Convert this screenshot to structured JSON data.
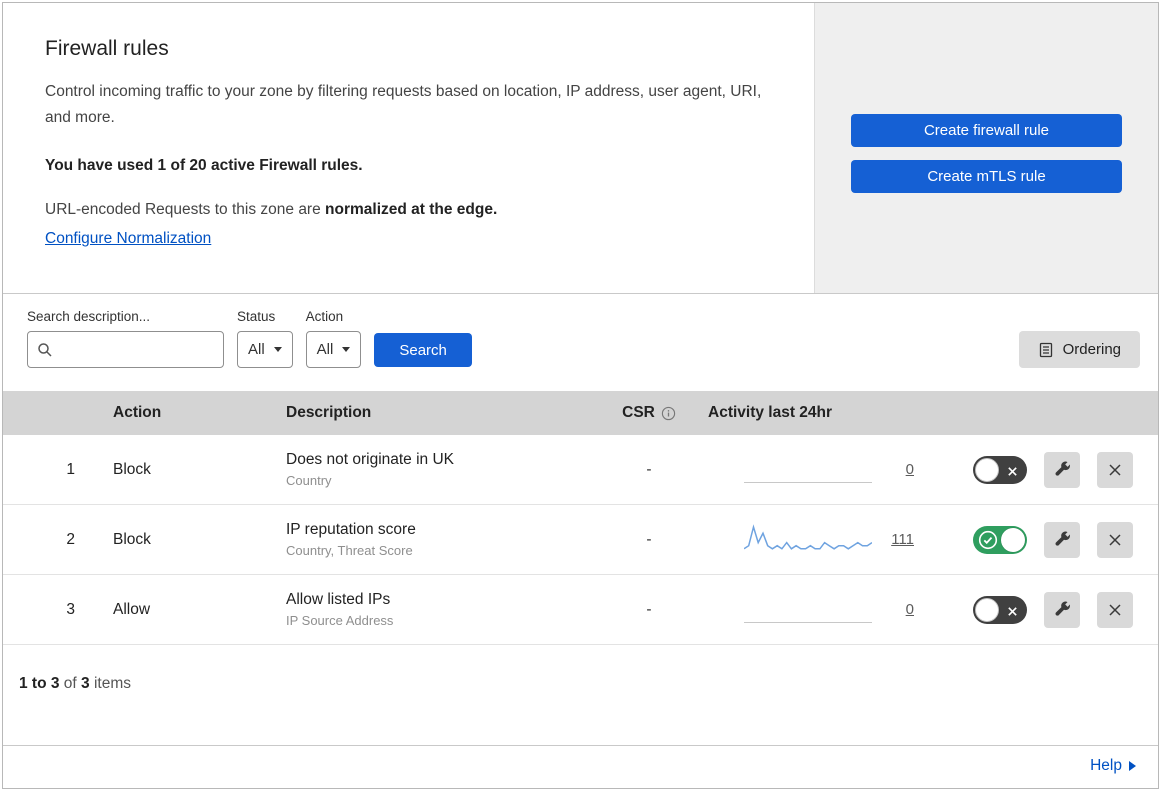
{
  "colors": {
    "primary_blue": "#1560d4",
    "link_blue": "#0051c3",
    "toggle_green": "#2f9e5f",
    "panel_gray": "#efefef",
    "table_header_gray": "#d4d4d4",
    "sparkline_blue": "#6fa3e0"
  },
  "header": {
    "title": "Firewall rules",
    "description": "Control incoming traffic to your zone by filtering requests based on location, IP address, user agent, URI, and more.",
    "usage_bold": "You have used 1 of 20 active Firewall rules.",
    "normalization_prefix": "URL-encoded Requests to this zone are",
    "normalization_bold": "normalized at the edge.",
    "normalization_link": "Configure Normalization",
    "create_firewall_button": "Create firewall rule",
    "create_mtls_button": "Create mTLS rule"
  },
  "filters": {
    "search_label": "Search description...",
    "status_label": "Status",
    "status_value": "All",
    "action_label": "Action",
    "action_value": "All",
    "search_button": "Search",
    "ordering_button": "Ordering"
  },
  "table": {
    "headers": {
      "action": "Action",
      "description": "Description",
      "csr": "CSR",
      "activity": "Activity last 24hr"
    },
    "rows": [
      {
        "index": "1",
        "action": "Block",
        "description": "Does not originate in UK",
        "criteria": "Country",
        "csr": "-",
        "activity_count": "0",
        "enabled": false,
        "sparkline": []
      },
      {
        "index": "2",
        "action": "Block",
        "description": "IP reputation score",
        "criteria": "Country, Threat Score",
        "csr": "-",
        "activity_count": "111",
        "enabled": true,
        "sparkline": [
          2,
          3,
          9,
          4,
          7,
          3,
          2,
          3,
          2,
          4,
          2,
          3,
          2,
          2,
          3,
          2,
          2,
          4,
          3,
          2,
          3,
          3,
          2,
          3,
          4,
          3,
          3,
          4
        ]
      },
      {
        "index": "3",
        "action": "Allow",
        "description": "Allow listed IPs",
        "criteria": "IP Source Address",
        "csr": "-",
        "activity_count": "0",
        "enabled": false,
        "sparkline": []
      }
    ]
  },
  "footer": {
    "range": "1 to 3",
    "of": "of",
    "total": "3",
    "items": "items"
  },
  "help": {
    "label": "Help"
  }
}
